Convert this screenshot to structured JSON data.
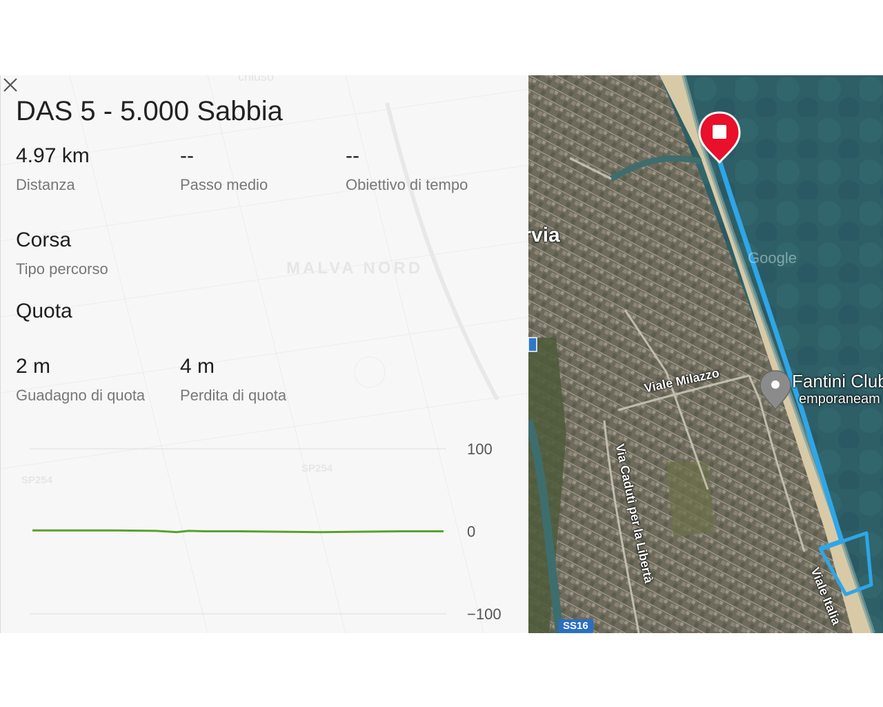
{
  "panel": {
    "title": "DAS 5 - 5.000 Sabbia",
    "stats": [
      {
        "value": "4.97 km",
        "label": "Distanza"
      },
      {
        "value": "--",
        "label": "Passo medio"
      },
      {
        "value": "--",
        "label": "Obiettivo di tempo"
      }
    ],
    "route_type": {
      "value": "Corsa",
      "label": "Tipo percorso"
    },
    "elevation": {
      "heading": "Quota",
      "gain": {
        "value": "2 m",
        "label": "Guadagno di quota"
      },
      "loss": {
        "value": "4 m",
        "label": "Perdita di quota"
      }
    },
    "background_labels": {
      "town": "MALVA NORD",
      "road1": "SP254",
      "road2": "SP254",
      "top": "chiuso"
    }
  },
  "chart_data": {
    "type": "line",
    "yticks": [
      "100",
      "0",
      "−100"
    ],
    "ylim": [
      -100,
      100
    ],
    "grid": true,
    "series": [
      {
        "color": "#5aa02c",
        "x": [
          0,
          0.1,
          0.2,
          0.3,
          0.35,
          0.38,
          0.42,
          0.5,
          0.6,
          0.7,
          0.8,
          0.9,
          1.0
        ],
        "values": [
          1,
          1,
          1,
          0.5,
          -1,
          0.5,
          0,
          0,
          -0.5,
          -1,
          -0.5,
          0,
          0
        ]
      }
    ]
  },
  "map": {
    "labels": {
      "city": "Cervia",
      "street1": "Viale Milazzo",
      "street2": "Via Caduti per la Libertà",
      "street3": "Viale Italia",
      "poi": "Fantini Club",
      "poi_sub": "emporaneam",
      "road_badge": "SS16",
      "watermark": "Google"
    },
    "route_color": "#2ea6e8",
    "marker_color": "#e8102a"
  }
}
